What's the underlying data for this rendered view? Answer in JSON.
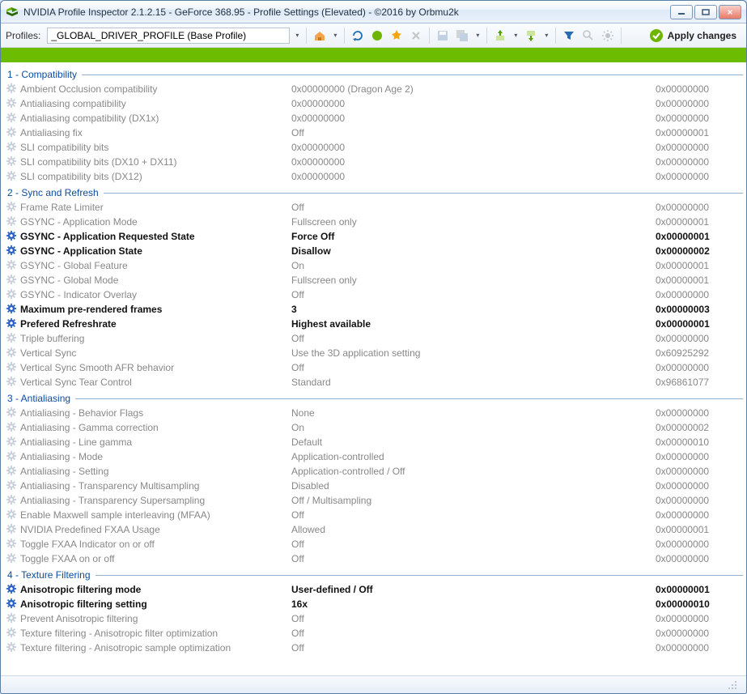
{
  "title": "NVIDIA Profile Inspector 2.1.2.15 - GeForce 368.95 - Profile Settings (Elevated) - ©2016 by Orbmu2k",
  "toolbar": {
    "profiles_label": "Profiles:",
    "profile_value": "_GLOBAL_DRIVER_PROFILE (Base Profile)",
    "apply_label": "Apply changes"
  },
  "sections": [
    {
      "title": "1 - Compatibility",
      "rows": [
        {
          "name": "Ambient Occlusion compatibility",
          "val": "0x00000000 (Dragon Age 2)",
          "hex": "0x00000000",
          "changed": false
        },
        {
          "name": "Antialiasing compatibility",
          "val": "0x00000000",
          "hex": "0x00000000",
          "changed": false
        },
        {
          "name": "Antialiasing compatibility (DX1x)",
          "val": "0x00000000",
          "hex": "0x00000000",
          "changed": false
        },
        {
          "name": "Antialiasing fix",
          "val": "Off",
          "hex": "0x00000001",
          "changed": false
        },
        {
          "name": "SLI compatibility bits",
          "val": "0x00000000",
          "hex": "0x00000000",
          "changed": false
        },
        {
          "name": "SLI compatibility bits (DX10 + DX11)",
          "val": "0x00000000",
          "hex": "0x00000000",
          "changed": false
        },
        {
          "name": "SLI compatibility bits (DX12)",
          "val": "0x00000000",
          "hex": "0x00000000",
          "changed": false
        }
      ]
    },
    {
      "title": "2 - Sync and Refresh",
      "rows": [
        {
          "name": "Frame Rate Limiter",
          "val": "Off",
          "hex": "0x00000000",
          "changed": false
        },
        {
          "name": "GSYNC - Application Mode",
          "val": "Fullscreen only",
          "hex": "0x00000001",
          "changed": false
        },
        {
          "name": "GSYNC - Application Requested State",
          "val": "Force Off",
          "hex": "0x00000001",
          "changed": true
        },
        {
          "name": "GSYNC - Application State",
          "val": "Disallow",
          "hex": "0x00000002",
          "changed": true
        },
        {
          "name": "GSYNC - Global Feature",
          "val": "On",
          "hex": "0x00000001",
          "changed": false
        },
        {
          "name": "GSYNC - Global Mode",
          "val": "Fullscreen only",
          "hex": "0x00000001",
          "changed": false
        },
        {
          "name": "GSYNC - Indicator Overlay",
          "val": "Off",
          "hex": "0x00000000",
          "changed": false
        },
        {
          "name": "Maximum pre-rendered frames",
          "val": "3",
          "hex": "0x00000003",
          "changed": true
        },
        {
          "name": "Prefered Refreshrate",
          "val": "Highest available",
          "hex": "0x00000001",
          "changed": true
        },
        {
          "name": "Triple buffering",
          "val": "Off",
          "hex": "0x00000000",
          "changed": false
        },
        {
          "name": "Vertical Sync",
          "val": "Use the 3D application setting",
          "hex": "0x60925292",
          "changed": false
        },
        {
          "name": "Vertical Sync Smooth AFR behavior",
          "val": "Off",
          "hex": "0x00000000",
          "changed": false
        },
        {
          "name": "Vertical Sync Tear Control",
          "val": "Standard",
          "hex": "0x96861077",
          "changed": false
        }
      ]
    },
    {
      "title": "3 - Antialiasing",
      "rows": [
        {
          "name": "Antialiasing - Behavior Flags",
          "val": "None",
          "hex": "0x00000000",
          "changed": false
        },
        {
          "name": "Antialiasing - Gamma correction",
          "val": "On",
          "hex": "0x00000002",
          "changed": false
        },
        {
          "name": "Antialiasing - Line gamma",
          "val": "Default",
          "hex": "0x00000010",
          "changed": false
        },
        {
          "name": "Antialiasing - Mode",
          "val": "Application-controlled",
          "hex": "0x00000000",
          "changed": false
        },
        {
          "name": "Antialiasing - Setting",
          "val": "Application-controlled / Off",
          "hex": "0x00000000",
          "changed": false
        },
        {
          "name": "Antialiasing - Transparency Multisampling",
          "val": "Disabled",
          "hex": "0x00000000",
          "changed": false
        },
        {
          "name": "Antialiasing - Transparency Supersampling",
          "val": "Off / Multisampling",
          "hex": "0x00000000",
          "changed": false
        },
        {
          "name": "Enable Maxwell sample interleaving (MFAA)",
          "val": "Off",
          "hex": "0x00000000",
          "changed": false
        },
        {
          "name": "NVIDIA Predefined FXAA Usage",
          "val": "Allowed",
          "hex": "0x00000001",
          "changed": false
        },
        {
          "name": "Toggle FXAA Indicator on or off",
          "val": "Off",
          "hex": "0x00000000",
          "changed": false
        },
        {
          "name": "Toggle FXAA on or off",
          "val": "Off",
          "hex": "0x00000000",
          "changed": false
        }
      ]
    },
    {
      "title": "4 - Texture Filtering",
      "rows": [
        {
          "name": "Anisotropic filtering mode",
          "val": "User-defined / Off",
          "hex": "0x00000001",
          "changed": true
        },
        {
          "name": "Anisotropic filtering setting",
          "val": "16x",
          "hex": "0x00000010",
          "changed": true
        },
        {
          "name": "Prevent Anisotropic filtering",
          "val": "Off",
          "hex": "0x00000000",
          "changed": false
        },
        {
          "name": "Texture filtering - Anisotropic filter optimization",
          "val": "Off",
          "hex": "0x00000000",
          "changed": false
        },
        {
          "name": "Texture filtering - Anisotropic sample optimization",
          "val": "Off",
          "hex": "0x00000000",
          "changed": false
        }
      ]
    }
  ]
}
